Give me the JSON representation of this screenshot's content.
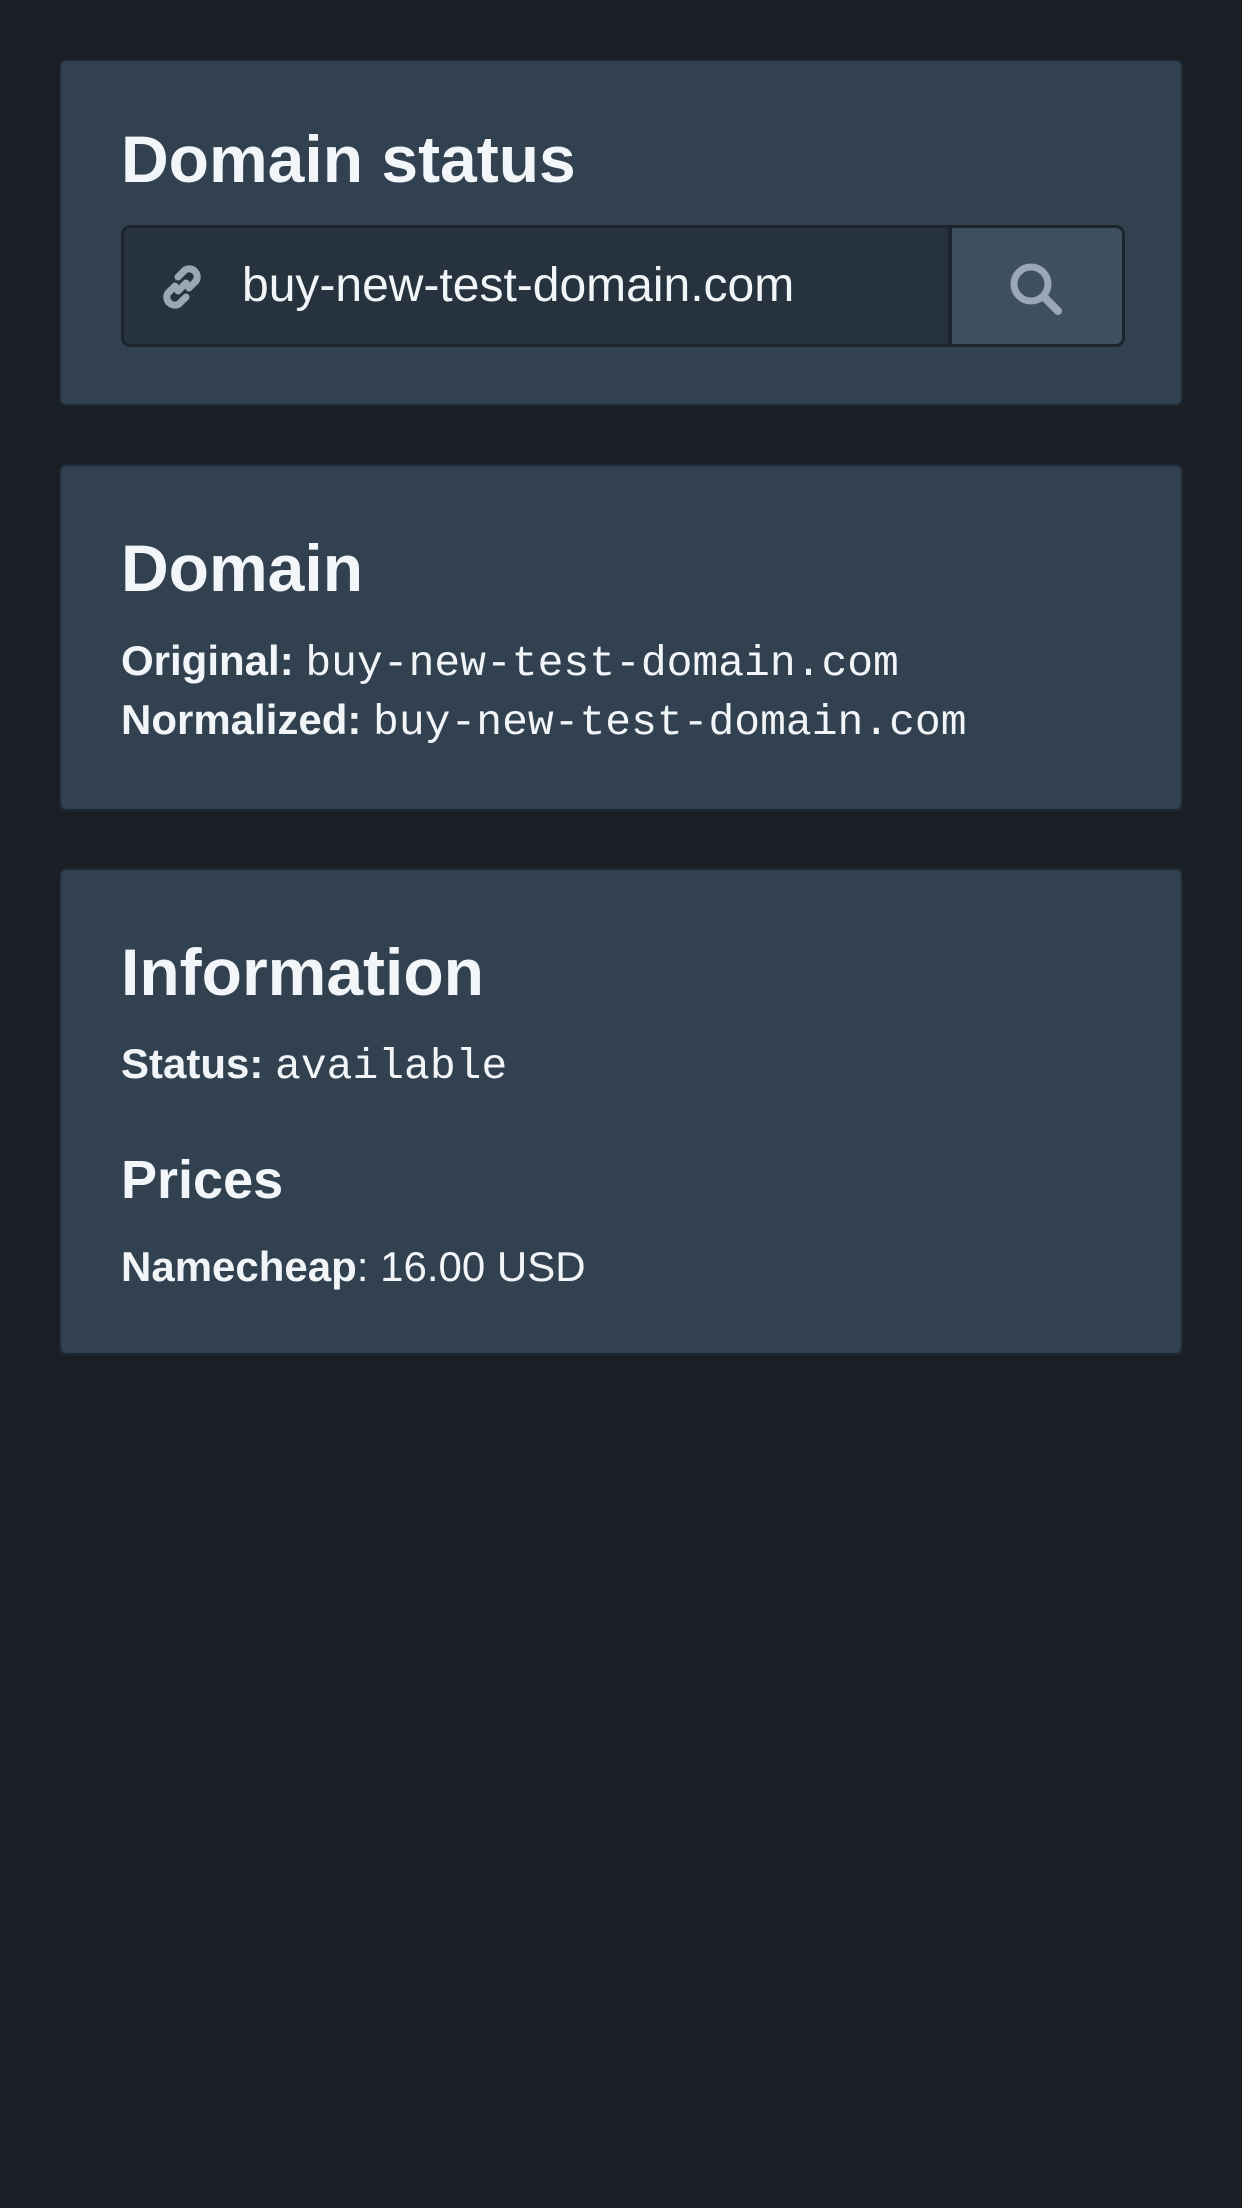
{
  "search_card": {
    "title": "Domain status",
    "input_value": "buy-new-test-domain.com"
  },
  "domain_card": {
    "title": "Domain",
    "original_label": "Original:",
    "original_value": "buy-new-test-domain.com",
    "normalized_label": "Normalized:",
    "normalized_value": "buy-new-test-domain.com"
  },
  "info_card": {
    "title": "Information",
    "status_label": "Status:",
    "status_value": "available",
    "prices_title": "Prices",
    "price_registrar": "Namecheap",
    "price_separator": ":",
    "price_value": "16.00 USD"
  },
  "colors": {
    "page_background": "#1a1f26",
    "card_background": "#314150",
    "input_background": "#26333f",
    "button_background": "#3e4f5f",
    "icon_color": "#9aa7b4",
    "text": "#f2f5f8"
  },
  "icons": {
    "input_icon": "link-icon",
    "button_icon": "search-icon"
  }
}
